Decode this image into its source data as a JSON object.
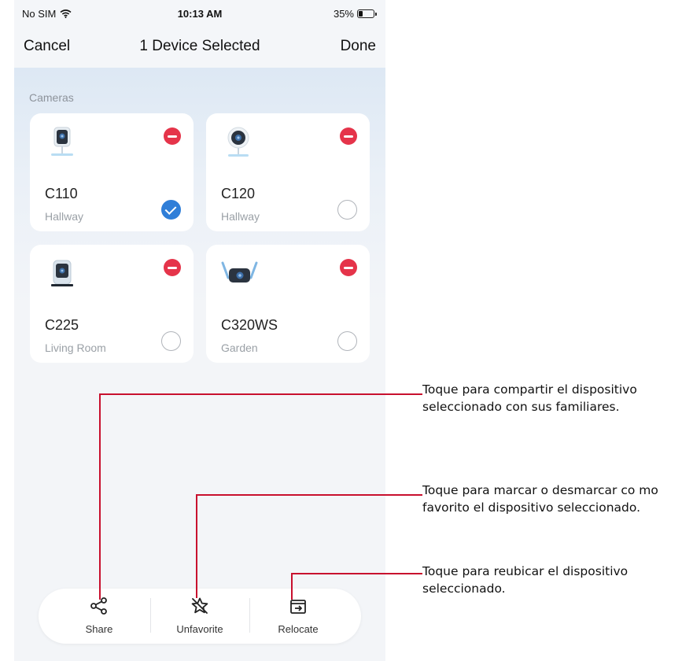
{
  "status_bar": {
    "carrier": "No SIM",
    "time": "10:13 AM",
    "battery_text": "35%",
    "battery_level": 0.35
  },
  "nav": {
    "cancel": "Cancel",
    "title": "1 Device Selected",
    "done": "Done"
  },
  "section_label": "Cameras",
  "devices": [
    {
      "name": "C110",
      "room": "Hallway",
      "selected": true,
      "icon": "camera-c110-icon"
    },
    {
      "name": "C120",
      "room": "Hallway",
      "selected": false,
      "icon": "camera-c120-icon"
    },
    {
      "name": "C225",
      "room": "Living Room",
      "selected": false,
      "icon": "camera-c225-icon"
    },
    {
      "name": "C320WS",
      "room": "Garden",
      "selected": false,
      "icon": "camera-c320ws-icon"
    }
  ],
  "actions": [
    {
      "label": "Share",
      "icon": "share-icon"
    },
    {
      "label": "Unfavorite",
      "icon": "star-slash-icon"
    },
    {
      "label": "Relocate",
      "icon": "relocate-icon"
    }
  ],
  "callouts": {
    "share": "Toque para compartir el dispositivo seleccionado con sus familiares.",
    "favorite": "Toque para marcar o desmarcar co mo favorito el dispositivo seleccionado.",
    "relocate": "Toque para reubicar el dispositivo seleccionado."
  },
  "colors": {
    "accent": "#2f7ed8",
    "remove": "#e5344a",
    "callout_line": "#c8102e"
  }
}
